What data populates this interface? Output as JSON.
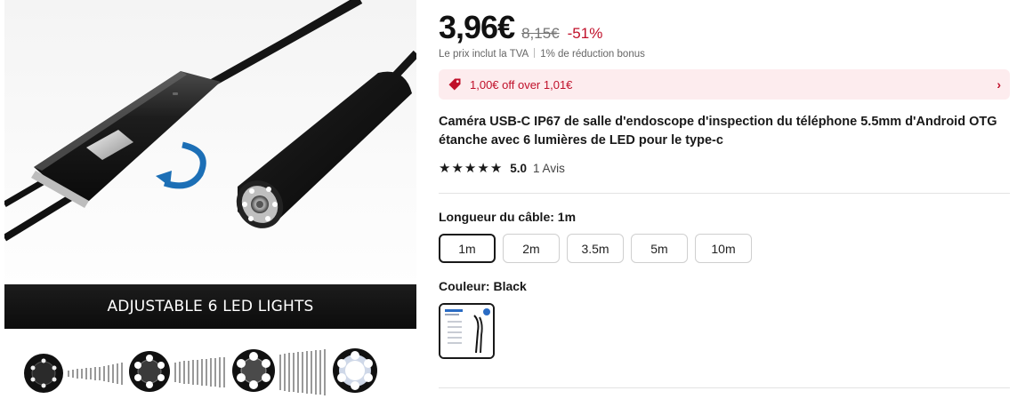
{
  "product_image": {
    "banner_text": "ADJUSTABLE 6 LED LIGHTS"
  },
  "price": {
    "current": "3,96€",
    "original": "8,15€",
    "discount": "-51%",
    "tax_note": "Le prix inclut la TVA",
    "bonus_note": "1% de réduction bonus"
  },
  "promo": {
    "text": "1,00€ off over 1,01€",
    "icon": "tag-icon",
    "color": "#c0102a",
    "background": "#fdecee"
  },
  "title": "Caméra USB-C IP67 de salle d'endoscope d'inspection du téléphone 5.5mm d'Android OTG étanche avec 6 lumières de LED pour le type-c",
  "rating": {
    "stars": 5,
    "score": "5.0",
    "reviews": "1 Avis"
  },
  "cable_length": {
    "label": "Longueur du câble:",
    "value": "1m",
    "options": [
      "1m",
      "2m",
      "3.5m",
      "5m",
      "10m"
    ]
  },
  "color_option": {
    "label": "Couleur:",
    "value": "Black"
  }
}
